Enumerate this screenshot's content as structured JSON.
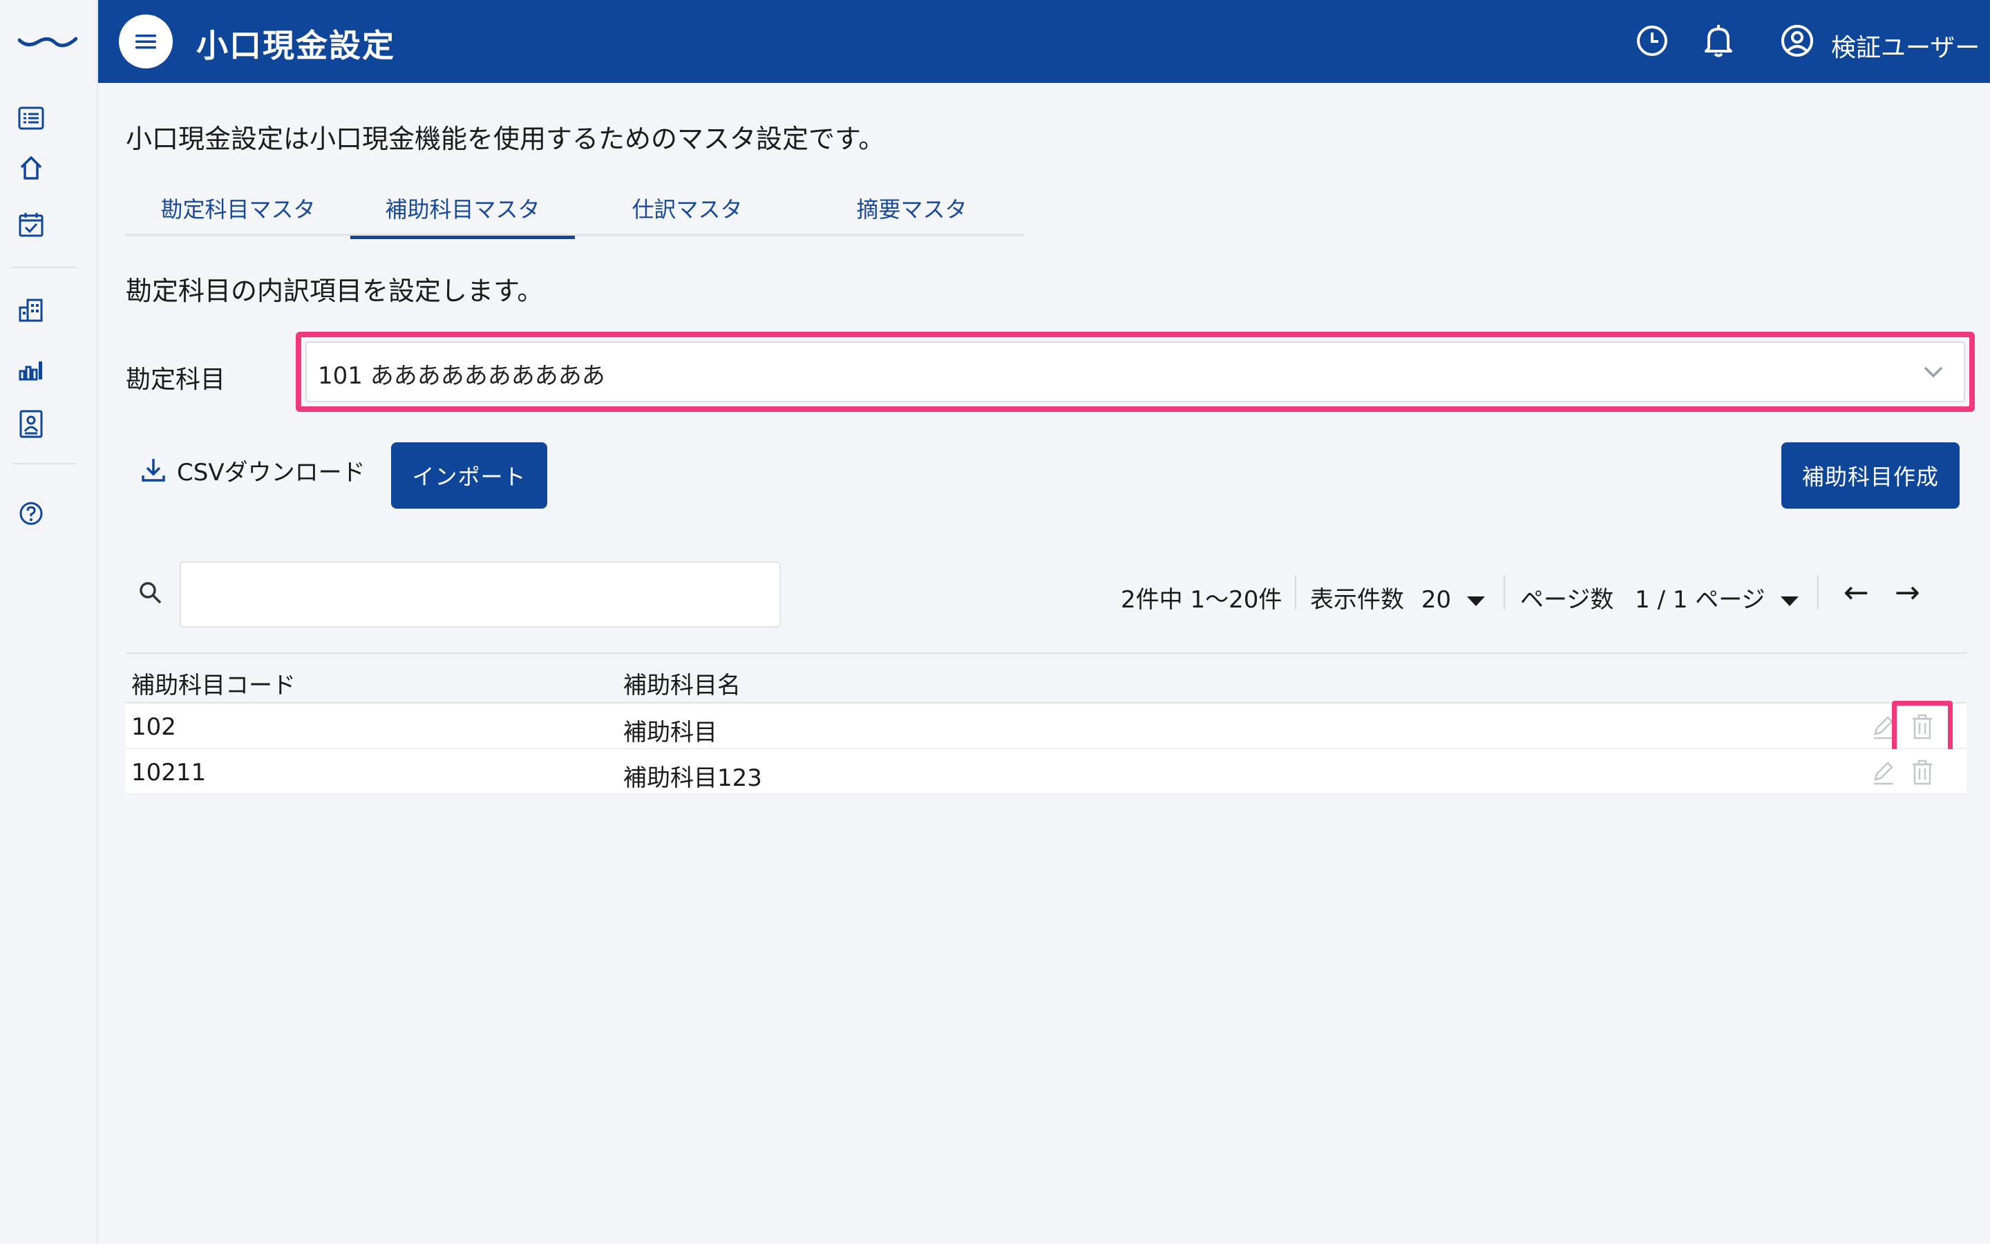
{
  "header": {
    "title": "小口現金設定",
    "user_name": "検証ユーザー",
    "bg_color": "#0f4699"
  },
  "sidebar": {
    "items": [
      {
        "icon": "list-icon"
      },
      {
        "icon": "home-icon"
      },
      {
        "icon": "calendar-check-icon"
      },
      {
        "icon": "building-icon"
      },
      {
        "icon": "bar-chart-icon"
      },
      {
        "icon": "id-badge-icon"
      },
      {
        "icon": "help-icon"
      }
    ]
  },
  "main": {
    "intro": "小口現金設定は小口現金機能を使用するためのマスタ設定です。",
    "tabs": [
      {
        "label": "勘定科目マスタ",
        "active": false
      },
      {
        "label": "補助科目マスタ",
        "active": true
      },
      {
        "label": "仕訳マスタ",
        "active": false
      },
      {
        "label": "摘要マスタ",
        "active": false
      }
    ],
    "section_desc": "勘定科目の内訳項目を設定します。",
    "account": {
      "label": "勘定科目",
      "value": "101 ああああああああああ"
    },
    "actions": {
      "csv_label": "CSVダウンロード",
      "import_label": "インポート",
      "create_label": "補助科目作成"
    },
    "search": {
      "value": "",
      "placeholder": ""
    },
    "pager": {
      "summary": "2件中 1〜20件",
      "per_page_label": "表示件数",
      "per_page_value": "20",
      "page_label": "ページ数",
      "page_value": "1 / 1 ページ",
      "prev": "←",
      "next": "→"
    },
    "table": {
      "columns": [
        "補助科目コード",
        "補助科目名"
      ],
      "rows": [
        {
          "code": "102",
          "name": "補助科目"
        },
        {
          "code": "10211",
          "name": "補助科目123"
        }
      ]
    }
  },
  "colors": {
    "accent": "#0f4699",
    "highlight": "#f1387a"
  }
}
